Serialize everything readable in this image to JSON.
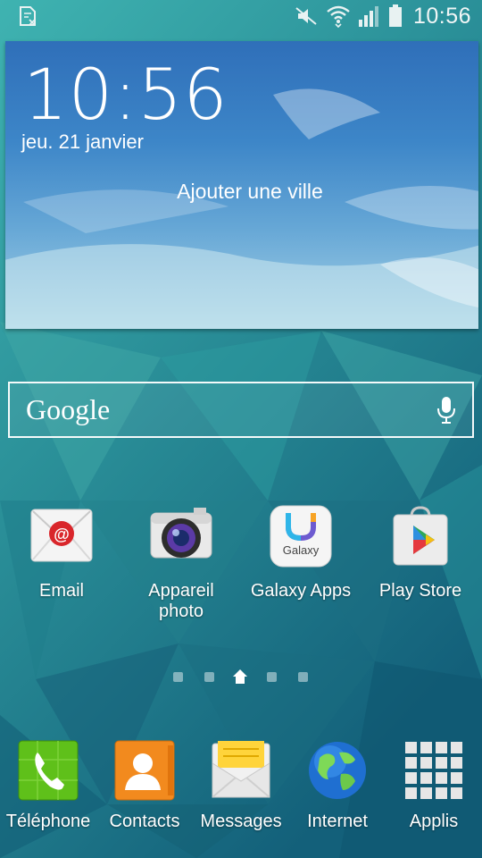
{
  "status_bar": {
    "time": "10:56",
    "icons": [
      "sim-card-icon",
      "mute-icon",
      "wifi-icon",
      "signal-icon",
      "battery-icon"
    ]
  },
  "widget": {
    "time": "10:56",
    "date": "jeu. 21 janvier",
    "add_city": "Ajouter une ville"
  },
  "search": {
    "label": "Google",
    "icon": "microphone-icon"
  },
  "apps": [
    {
      "label": "Email",
      "icon": "email-icon"
    },
    {
      "label": "Appareil\nphoto",
      "icon": "camera-icon"
    },
    {
      "label": "Galaxy Apps",
      "icon": "galaxy-apps-icon",
      "icon_text": "Galaxy"
    },
    {
      "label": "Play Store",
      "icon": "play-store-icon"
    }
  ],
  "pager": {
    "pages": 5,
    "current": 3
  },
  "dock": [
    {
      "label": "Téléphone",
      "icon": "phone-icon"
    },
    {
      "label": "Contacts",
      "icon": "contacts-icon"
    },
    {
      "label": "Messages",
      "icon": "messages-icon"
    },
    {
      "label": "Internet",
      "icon": "internet-icon"
    },
    {
      "label": "Applis",
      "icon": "apps-grid-icon"
    }
  ],
  "colors": {
    "wallpaper_light": "#3fb3b1",
    "wallpaper_dark": "#0f5a73",
    "widget_sky": "#3d86c8"
  }
}
